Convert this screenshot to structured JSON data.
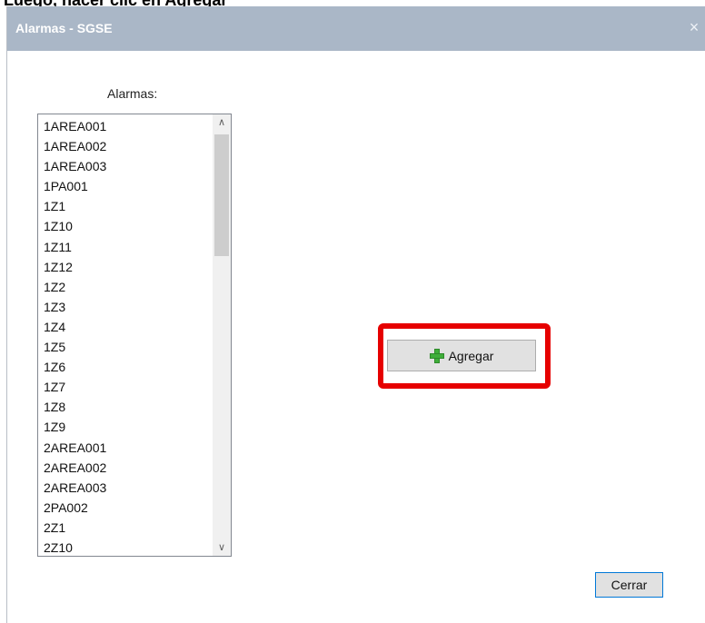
{
  "top_caption": "Luego, hacer clic en Agregar",
  "dialog": {
    "title": "Alarmas - SGSE",
    "close_symbol": "×"
  },
  "alarms": {
    "label": "Alarmas:",
    "items": [
      "1AREA001",
      "1AREA002",
      "1AREA003",
      "1PA001",
      "1Z1",
      "1Z10",
      "1Z11",
      "1Z12",
      "1Z2",
      "1Z3",
      "1Z4",
      "1Z5",
      "1Z6",
      "1Z7",
      "1Z8",
      "1Z9",
      "2AREA001",
      "2AREA002",
      "2AREA003",
      "2PA002",
      "2Z1",
      "2Z10"
    ],
    "scroll_up": "∧",
    "scroll_down": "∨"
  },
  "add_button": {
    "label": "Agregar",
    "icon": "plus-icon",
    "icon_color": "#3fae3a"
  },
  "close_button": {
    "label": "Cerrar"
  },
  "colors": {
    "titlebar": "#aab7c7",
    "highlight": "#e60000",
    "focus_border": "#0078d7"
  }
}
